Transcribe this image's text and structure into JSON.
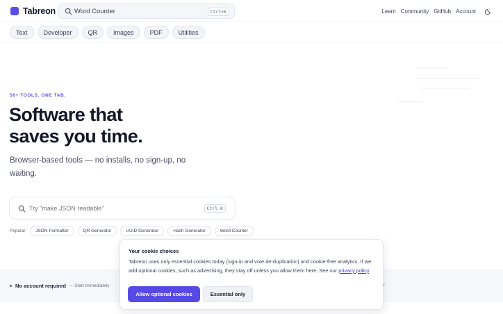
{
  "header": {
    "brand": "Tabreon",
    "search": {
      "value": "Word Counter",
      "shortcut": "Ctrl+K"
    },
    "nav": [
      "Learn",
      "Community",
      "GitHub",
      "Account"
    ]
  },
  "categories": [
    "Text",
    "Developer",
    "QR",
    "Images",
    "PDF",
    "Utilities"
  ],
  "hero": {
    "eyebrow": "56+ TOOLS. ONE TAB.",
    "title_line1": "Software that",
    "title_line2": "saves you time.",
    "subtitle": "Browser-based tools — no installs, no sign-up, no waiting.",
    "search_placeholder": "Try \"make JSON readable\"",
    "search_shortcut": "Ctrl K",
    "popular_label": "Popular:",
    "popular": [
      "JSON Formatter",
      "QR Generator",
      "UUID Generator",
      "Hash Generator",
      "Word Counter"
    ]
  },
  "band": {
    "strong": "No account required",
    "rest": "— Start immediately",
    "tail": "r"
  },
  "cookie": {
    "title": "Your cookie choices",
    "body": "Tabreon uses only essential cookies today (sign-in and vote de-duplication) and cookie-free analytics. If we add optional cookies, such as advertising, they stay off unless you allow them here. See our",
    "link": "privacy policy",
    "end": ".",
    "allow_label": "Allow optional cookies",
    "essential_label": "Essential only"
  },
  "colors": {
    "accent": "#5b4ee8",
    "primary_button": "#5749e6"
  }
}
